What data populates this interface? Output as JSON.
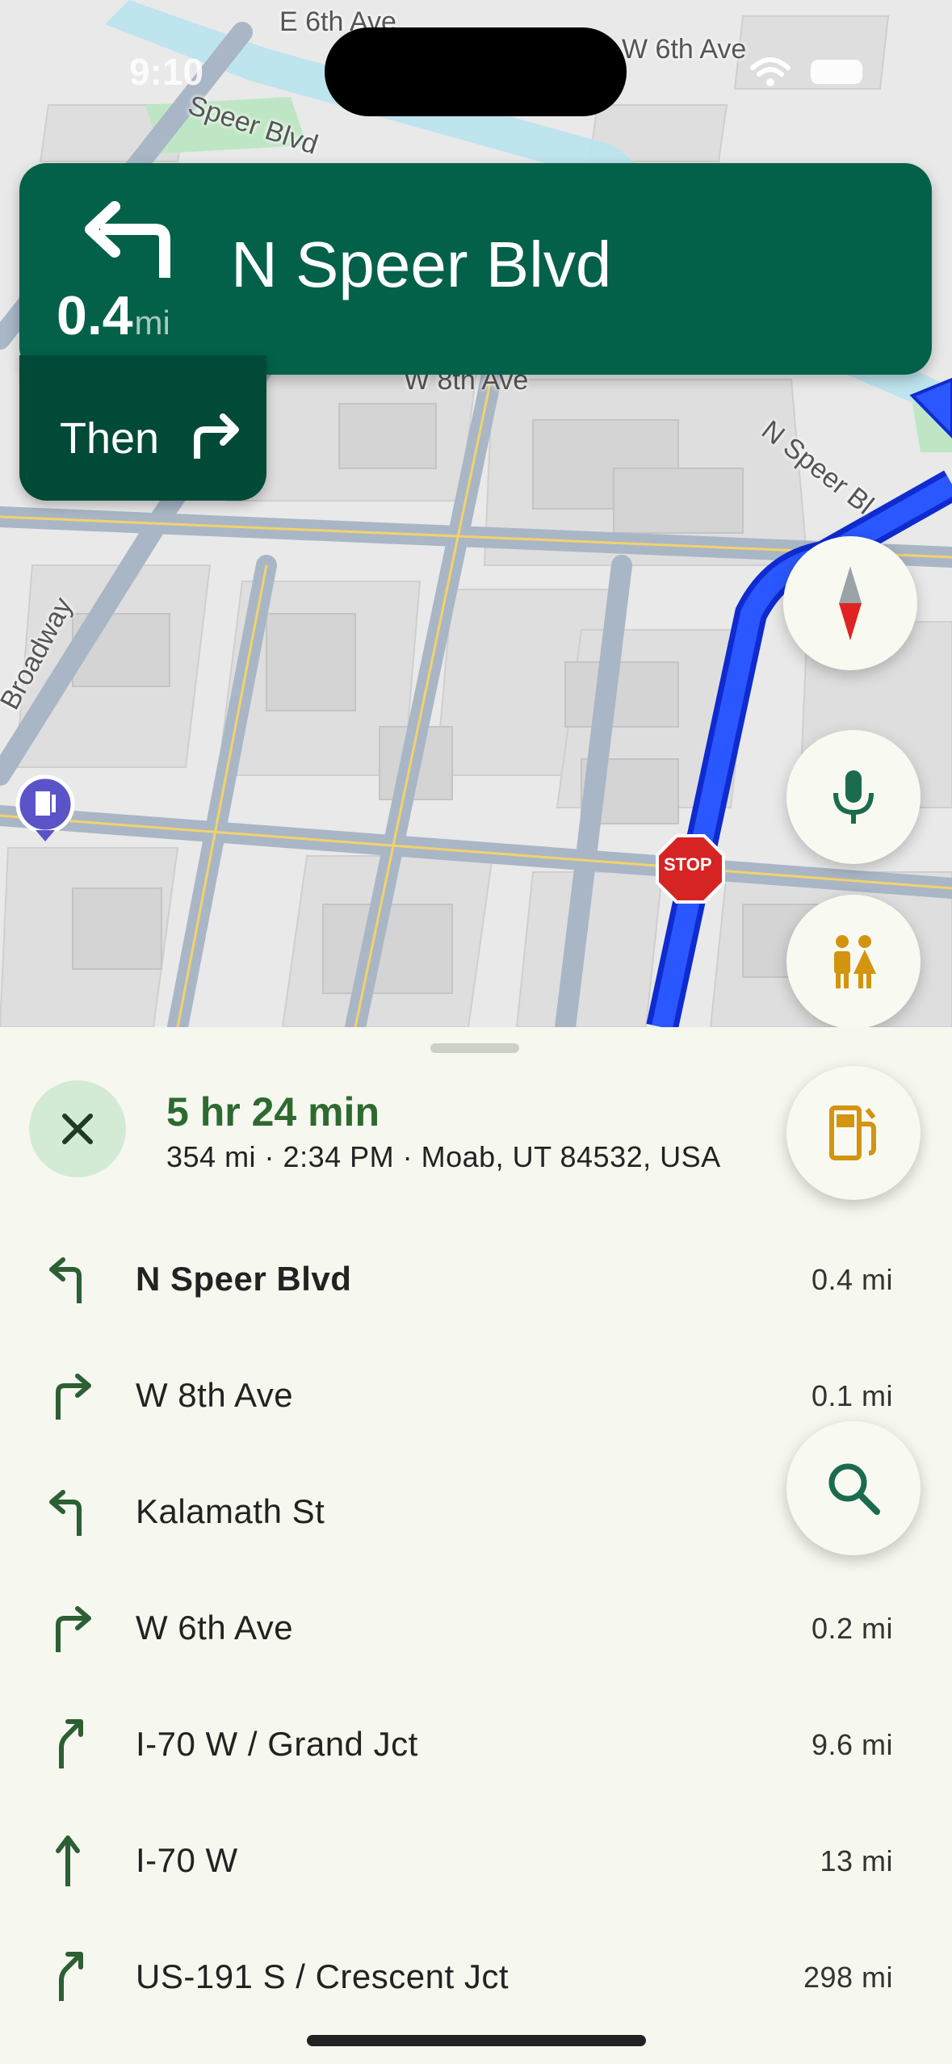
{
  "status": {
    "time": "9:10"
  },
  "map": {
    "streets": {
      "e6th": "E 6th Ave",
      "w6th": "W 6th Ave",
      "speer_top": "Speer Blvd",
      "w8th": "W 8th Ave",
      "nspeer": "N Speer Bl",
      "broadway": "Broadway"
    },
    "stop_sign": "STOP"
  },
  "maneuver": {
    "distance": "0.4",
    "unit": "mi",
    "street": "N Speer Blvd",
    "then_label": "Then"
  },
  "trip": {
    "eta": "5 hr 24 min",
    "meta": "354 mi · 2:34 PM · Moab, UT 84532, USA"
  },
  "steps": [
    {
      "icon": "turn-left-icon",
      "name": "N Speer Blvd",
      "distance": "0.4 mi"
    },
    {
      "icon": "turn-right-icon",
      "name": "W 8th Ave",
      "distance": "0.1 mi"
    },
    {
      "icon": "turn-left-icon",
      "name": "Kalamath St",
      "distance": ""
    },
    {
      "icon": "turn-right-icon",
      "name": "W 6th Ave",
      "distance": "0.2 mi"
    },
    {
      "icon": "slight-right-icon",
      "name": "I-70 W / Grand Jct",
      "distance": "9.6 mi"
    },
    {
      "icon": "straight-icon",
      "name": "I-70 W",
      "distance": "13 mi"
    },
    {
      "icon": "slight-right-icon",
      "name": "US-191 S / Crescent Jct",
      "distance": "298 mi"
    }
  ],
  "colors": {
    "nav_green": "#03614a",
    "then_green": "#024a38",
    "route_blue": "#1a3cff",
    "eta_green": "#2e6a30",
    "amber_icon": "#d39410"
  }
}
